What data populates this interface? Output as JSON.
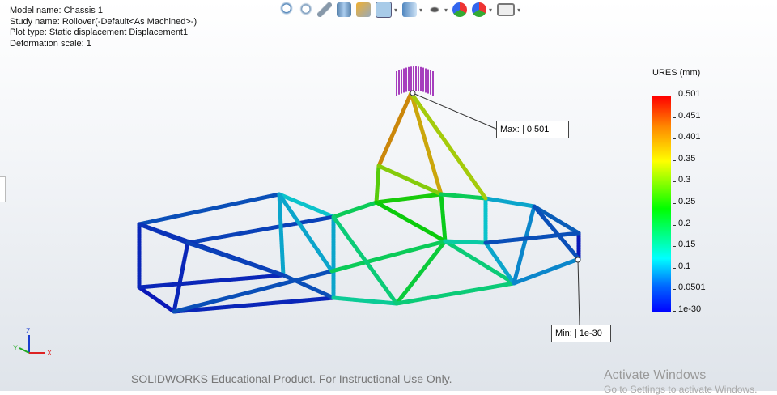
{
  "info": {
    "model": "Model name: Chassis 1",
    "study": "Study name: Rollover(-Default<As Machined>-)",
    "plot": "Plot type: Static displacement Displacement1",
    "scale": "Deformation scale: 1"
  },
  "toolbar": [
    "zoom-to-fit-icon",
    "zoom-to-area-icon",
    "previous-view-icon",
    "section-view-icon",
    "dynamic-annotation-icon",
    "view-orientation-icon",
    "display-style-icon",
    "hide-show-icon",
    "edit-appearance-icon",
    "apply-scene-icon",
    "view-settings-icon"
  ],
  "legend": {
    "title": "URES (mm)",
    "ticks": [
      "0.501",
      "0.451",
      "0.401",
      "0.35",
      "0.3",
      "0.25",
      "0.2",
      "0.15",
      "0.1",
      "0.0501",
      "1e-30"
    ],
    "colors": [
      "#ff0000",
      "#ffff00",
      "#00ff00",
      "#00ffff",
      "#0000ff"
    ]
  },
  "max": {
    "label": "Max:",
    "value": "0.501"
  },
  "min": {
    "label": "Min:",
    "value": "1e-30"
  },
  "watermark": "SOLIDWORKS Educational Product. For Instructional Use Only.",
  "activate": {
    "title": "Activate Windows",
    "sub": "Go to Settings to activate Windows."
  },
  "triad": {
    "x": "X",
    "y": "Y",
    "z": "Z"
  }
}
